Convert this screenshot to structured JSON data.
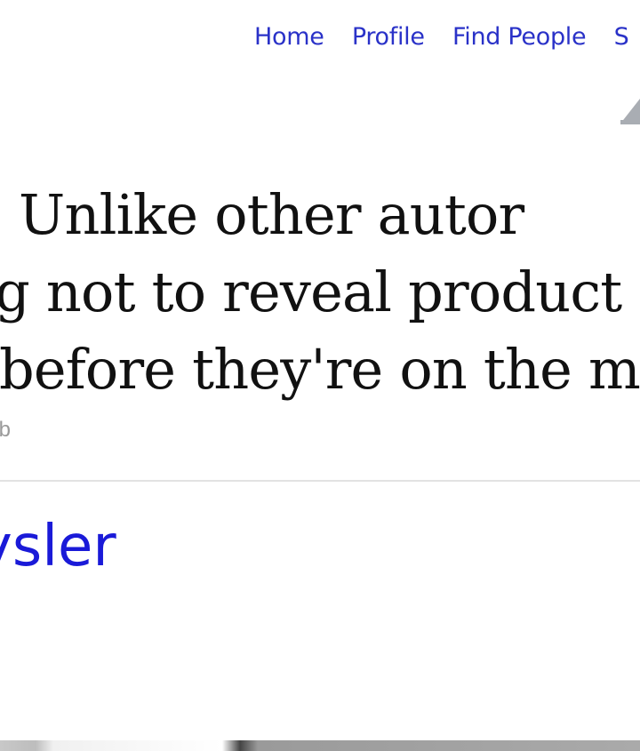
{
  "nav": {
    "items": [
      {
        "label": "Home"
      },
      {
        "label": "Profile"
      },
      {
        "label": "Find People"
      },
      {
        "label": "S"
      }
    ]
  },
  "tweet": {
    "lines": [
      "illes: Unlike other autor",
      "ng not to reveal product",
      "before they're on the m"
    ],
    "meta": "web"
  },
  "author": {
    "name": "ysler"
  },
  "colors": {
    "link": "#2a32c8",
    "author_link": "#1a1ad8",
    "text": "#111111",
    "meta": "#9a9a9a",
    "divider": "#e2e2e2"
  }
}
